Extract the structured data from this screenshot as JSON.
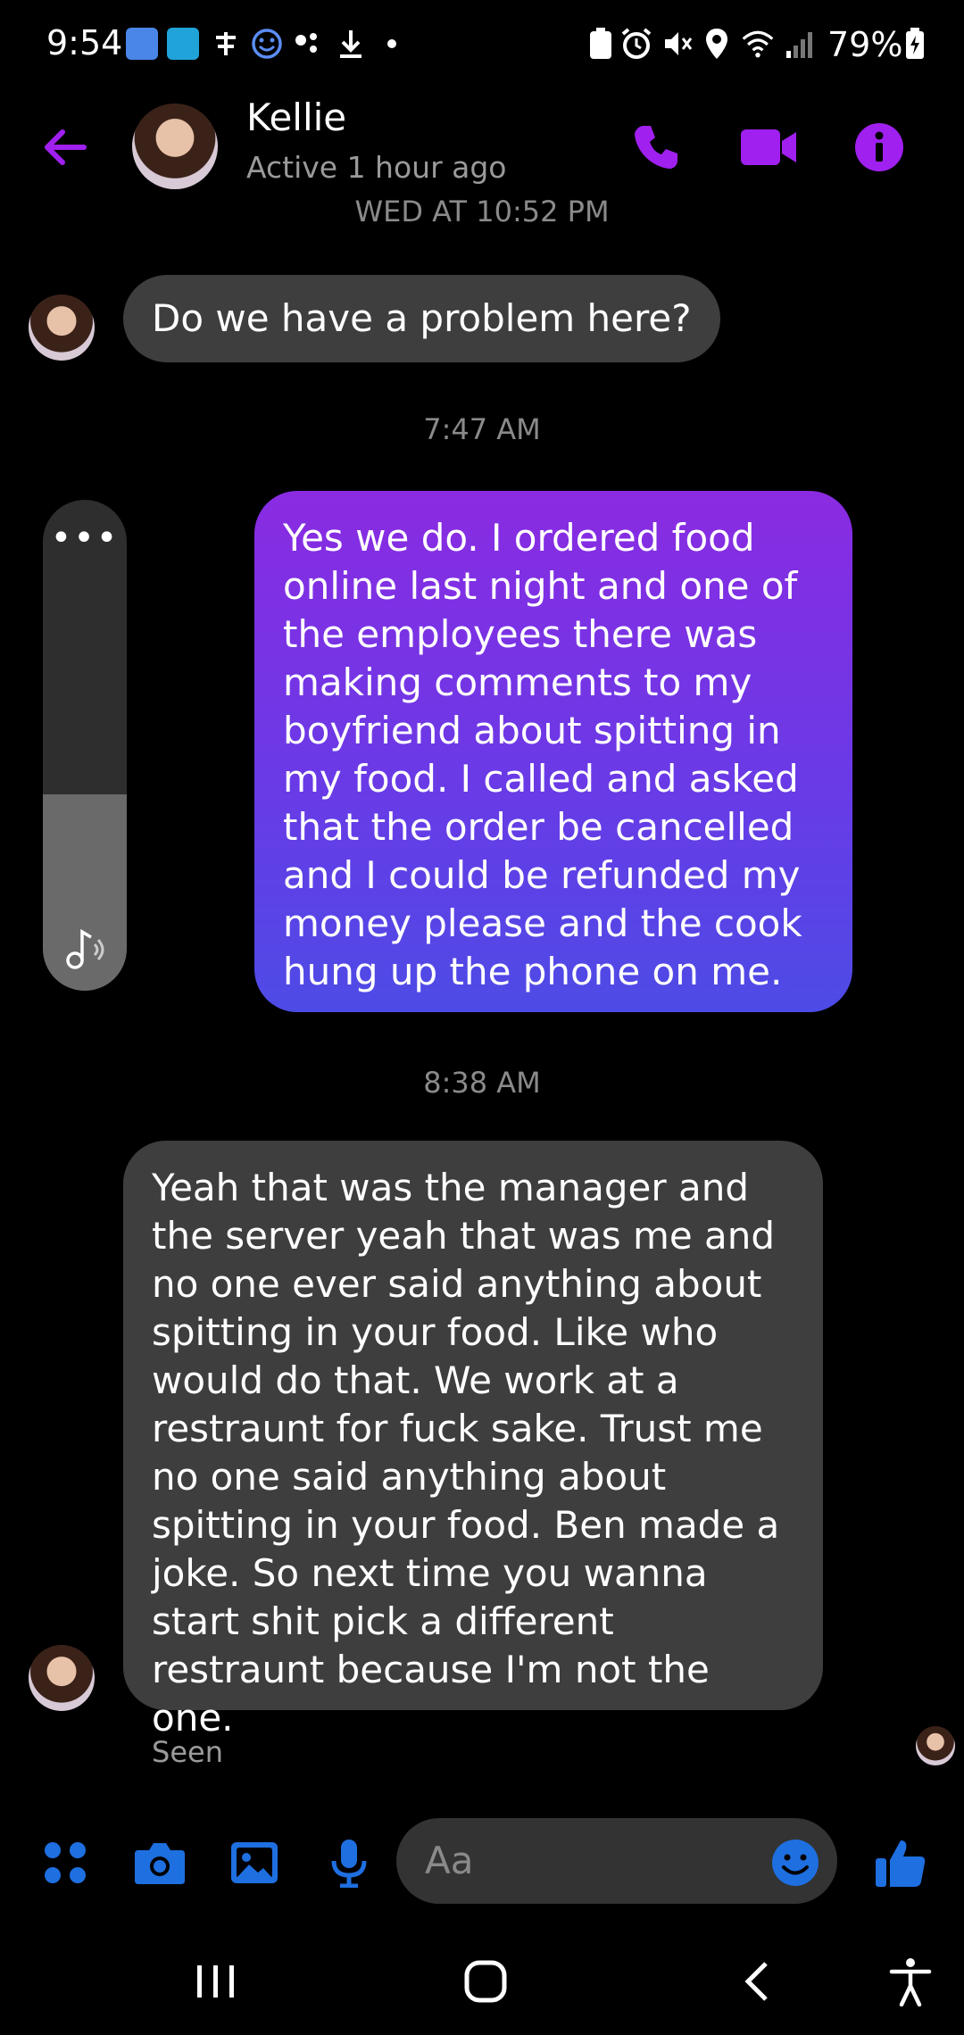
{
  "status_bar": {
    "time": "9:54",
    "battery": "79%",
    "icons_left": [
      "people-icon",
      "camera-app-icon",
      "fan-icon",
      "smile-icon",
      "assistant-icon",
      "download-icon",
      "dot-icon"
    ],
    "icons_right": [
      "battery-saver-icon",
      "alarm-icon",
      "mute-icon",
      "location-icon",
      "wifi-icon",
      "signal-icon",
      "battery-icon"
    ]
  },
  "header": {
    "contact_name": "Kellie",
    "contact_status": "Active 1 hour ago",
    "accent_color": "#a020f0"
  },
  "conversation": {
    "timestamps": [
      "WED AT 10:52 PM",
      "7:47 AM",
      "8:38 AM"
    ],
    "message_1": "Do we have a problem here?",
    "message_2": "Yes we do. I ordered food online last night and one of the employees there was making comments to my boyfriend about spitting in my food. I called and asked that the order be cancelled and I could be refunded my money please and the cook hung up the phone on me.",
    "message_3": "Yeah that was the manager and the server yeah that was me and no one ever said anything about spitting in your food. Like who would do that. We work at a restraunt for fuck sake. Trust me no one said anything about spitting in your food. Ben made a joke.  So next time you wanna start shit pick a different restraunt because I'm not the one.",
    "seen_label": "Seen"
  },
  "volume_panel": {
    "dots": "•••",
    "level": 0.4
  },
  "composer": {
    "placeholder": "Aa",
    "icon_color": "#1e6fe0"
  }
}
